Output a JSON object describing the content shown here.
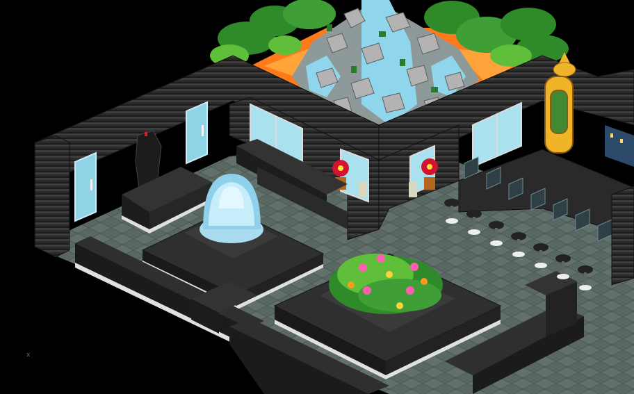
{
  "room": {
    "colors": {
      "background": "#000000",
      "floor_light": "#5f6e69",
      "floor_dark": "#4d5a56",
      "wall_dark": "#262626",
      "wall_mid": "#3a3a3a",
      "wall_light": "#505050",
      "sofa_top": "#2f2f2f",
      "sofa_side": "#1d1d1d",
      "sofa_trim": "#e0e0e0",
      "water": "#a9dcf0",
      "water_light": "#e4f6ff",
      "glass": "#a9e1ee",
      "lava": "#ff7a1a",
      "palm": "#2f8a2a",
      "palm_light": "#5fbf3a",
      "rock": "#a9a9a9",
      "rock_dark": "#6d6d6d",
      "gold": "#f0b428",
      "flower_red": "#e0103a",
      "flower_pink": "#ff5fb0",
      "flower_yellow": "#ffd23a"
    },
    "objects": {
      "waterfall": "rock-waterfall",
      "fountain": "water-fountain",
      "planter": "flower-planter",
      "doors": [
        "glass-door",
        "glass-door"
      ],
      "windows": [
        "window",
        "window",
        "window",
        "window"
      ],
      "poinsettias": [
        "potted-poinsettia",
        "potted-poinsettia"
      ],
      "statue": "dark-dragon-statue",
      "lamp": "golden-arabian-lamp",
      "computers": 7,
      "bar_stools": 8
    }
  },
  "corner_mark": "x"
}
